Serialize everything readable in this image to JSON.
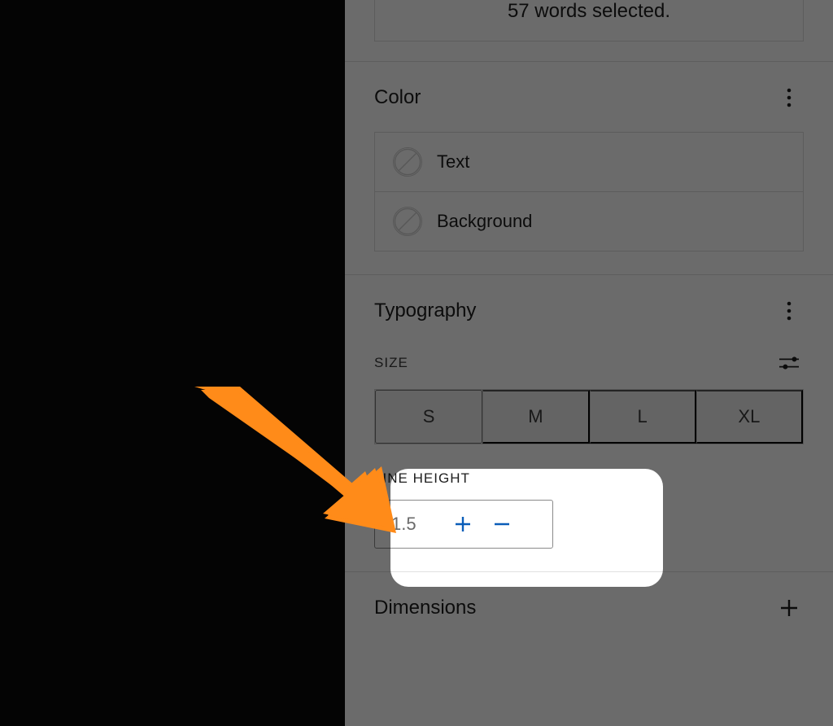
{
  "selection": {
    "text": "57 words selected."
  },
  "color": {
    "title": "Color",
    "rows": [
      {
        "label": "Text"
      },
      {
        "label": "Background"
      }
    ]
  },
  "typography": {
    "title": "Typography",
    "size_label": "SIZE",
    "sizes": [
      "S",
      "M",
      "L",
      "XL"
    ],
    "line_height_label": "LINE HEIGHT",
    "line_height_value": "1.5"
  },
  "dimensions": {
    "title": "Dimensions"
  },
  "colors": {
    "accent": "#0a5db8",
    "arrow": "#ff8b19"
  }
}
